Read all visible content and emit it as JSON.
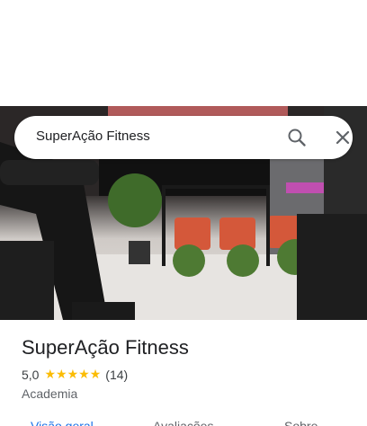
{
  "search": {
    "query": "SuperAção Fitness",
    "search_icon": "search-icon",
    "close_icon": "close-icon"
  },
  "place": {
    "name": "SuperAção Fitness",
    "rating": "5,0",
    "stars": 5,
    "review_count": "(14)",
    "category": "Academia"
  },
  "tabs": [
    {
      "label": "Visão geral"
    },
    {
      "label": "Avaliações"
    },
    {
      "label": "Sobre"
    }
  ],
  "colors": {
    "star": "#fbbc04",
    "active_tab": "#1a73e8"
  }
}
